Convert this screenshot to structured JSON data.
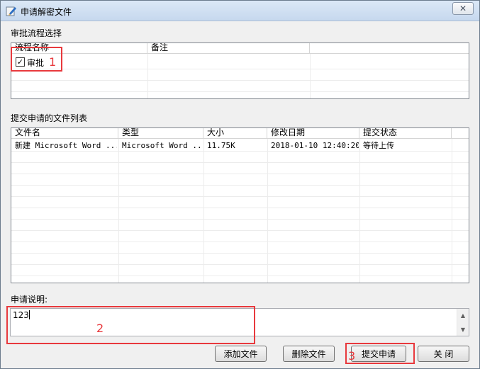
{
  "window": {
    "title": "申请解密文件",
    "close_glyph": "✕"
  },
  "approval": {
    "section_label": "审批流程选择",
    "columns": [
      "流程名称",
      "备注"
    ],
    "rows": [
      {
        "name": "审批",
        "checked": true,
        "check_glyph": "✓"
      }
    ]
  },
  "files": {
    "section_label": "提交申请的文件列表",
    "columns": [
      "文件名",
      "类型",
      "大小",
      "修改日期",
      "提交状态"
    ],
    "rows": [
      {
        "name": "新建 Microsoft Word ...",
        "type": "Microsoft Word ...",
        "size": "11.75K",
        "modified": "2018-01-10 12:40:20",
        "status": "等待上传"
      }
    ]
  },
  "note": {
    "label": "申请说明:",
    "value": "123"
  },
  "buttons": {
    "add_file": "添加文件",
    "delete_file": "删除文件",
    "submit": "提交申请",
    "close": "关 闭"
  },
  "annotations": [
    "1",
    "2",
    "3"
  ],
  "colors": {
    "annotation": "#e8393d",
    "titlebar": "#c6d8ee"
  }
}
